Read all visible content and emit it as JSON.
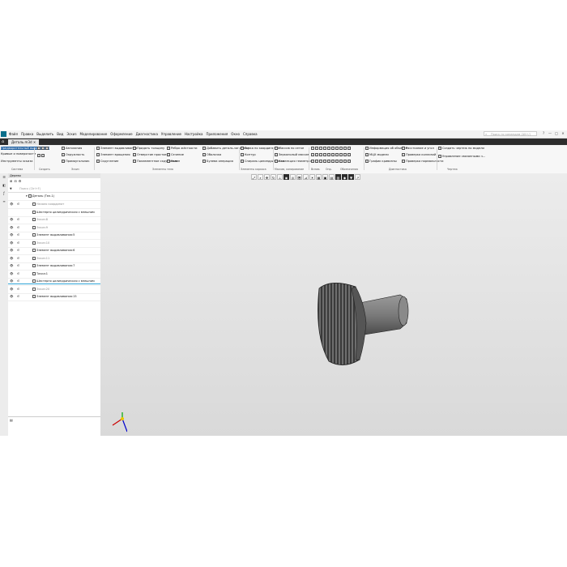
{
  "menu": [
    "Файл",
    "Правка",
    "Выделить",
    "Вид",
    "Эскиз",
    "Моделирование",
    "Оформление",
    "Диагностика",
    "Управление",
    "Настройка",
    "Приложения",
    "Окно",
    "Справка"
  ],
  "search": {
    "placeholder": "Поиск по командам (Alt+/)"
  },
  "window_controls": [
    "?",
    "—",
    "□",
    "✕"
  ],
  "document_tab": "Деталь.m3d",
  "ribbon": {
    "system": [
      "Предварительный выделенный",
      "Кривые и поверхности",
      "Инструменты эскиза"
    ],
    "create_small": [
      "Автолиния",
      "Окружность",
      "Прямоугольник"
    ],
    "sketch_ops": [
      "Элемент выдавливания",
      "Элемент вращения",
      "Скругление"
    ],
    "elements": [
      "Придать толщину",
      "Отверстие простое",
      "Поэлементное скругление"
    ],
    "elements2": [
      "Ребро жёсткости",
      "Сечение",
      "Уклон"
    ],
    "elements3": [
      "Добавить деталь-заготовку",
      "Оболочка",
      "Булева операция"
    ],
    "spatial": [
      "Точка по координатам",
      "Контур",
      "Спираль цилиндрическая"
    ],
    "arrays": [
      "Массив по сетке",
      "Зеркальный массив",
      "Коллекция геометрии"
    ],
    "diag": [
      "Информация об объекте",
      "МЦХ модели",
      "График кривизны"
    ],
    "diag2": [
      "Расстояние и угол",
      "Проверка коллизий",
      "Проверка нормальности"
    ],
    "drawing": [
      "Создать чертеж по модели",
      "Управление связанными ч..."
    ],
    "group_labels": [
      "Система",
      "Создать",
      "Эскиз",
      "Элементы тела",
      "Элементы каркаса",
      "Массив, копирование",
      "Вспом.",
      "Опр.",
      "Обозначения",
      "Диагностика",
      "Чертеж"
    ]
  },
  "tree": {
    "panel_title": "Дерево",
    "filter_placeholder": "Поиск (Ctrl+F)",
    "root": "Деталь (Тел-1)",
    "items": [
      {
        "label": "Начало координат",
        "dim": true,
        "indent": 1
      },
      {
        "label": "Шестерня цилиндрическая с внешним",
        "dim": false,
        "indent": 1
      },
      {
        "label": "Эскиз:8",
        "dim": true,
        "indent": 1
      },
      {
        "label": "Эскиз:9",
        "dim": true,
        "indent": 1
      },
      {
        "label": "Элемент выдавливания:5",
        "dim": false,
        "indent": 1
      },
      {
        "label": "Эскиз:10",
        "dim": true,
        "indent": 1
      },
      {
        "label": "Элемент выдавливания:6",
        "dim": false,
        "indent": 1
      },
      {
        "label": "Эскиз:11",
        "dim": true,
        "indent": 1
      },
      {
        "label": "Элемент выдавливания:7",
        "dim": false,
        "indent": 1
      },
      {
        "label": "Точка:1",
        "dim": false,
        "indent": 1
      },
      {
        "label": "Шестерня цилиндрическая с внешним",
        "dim": false,
        "indent": 1
      },
      {
        "label": "Эскиз:20",
        "dim": true,
        "indent": 1
      },
      {
        "label": "Элемент выдавливания:15",
        "dim": false,
        "indent": 1
      }
    ]
  },
  "colors": {
    "accent": "#2ea3d6",
    "tab_bar": "#2d2d2d",
    "viewport": "#dedede"
  }
}
